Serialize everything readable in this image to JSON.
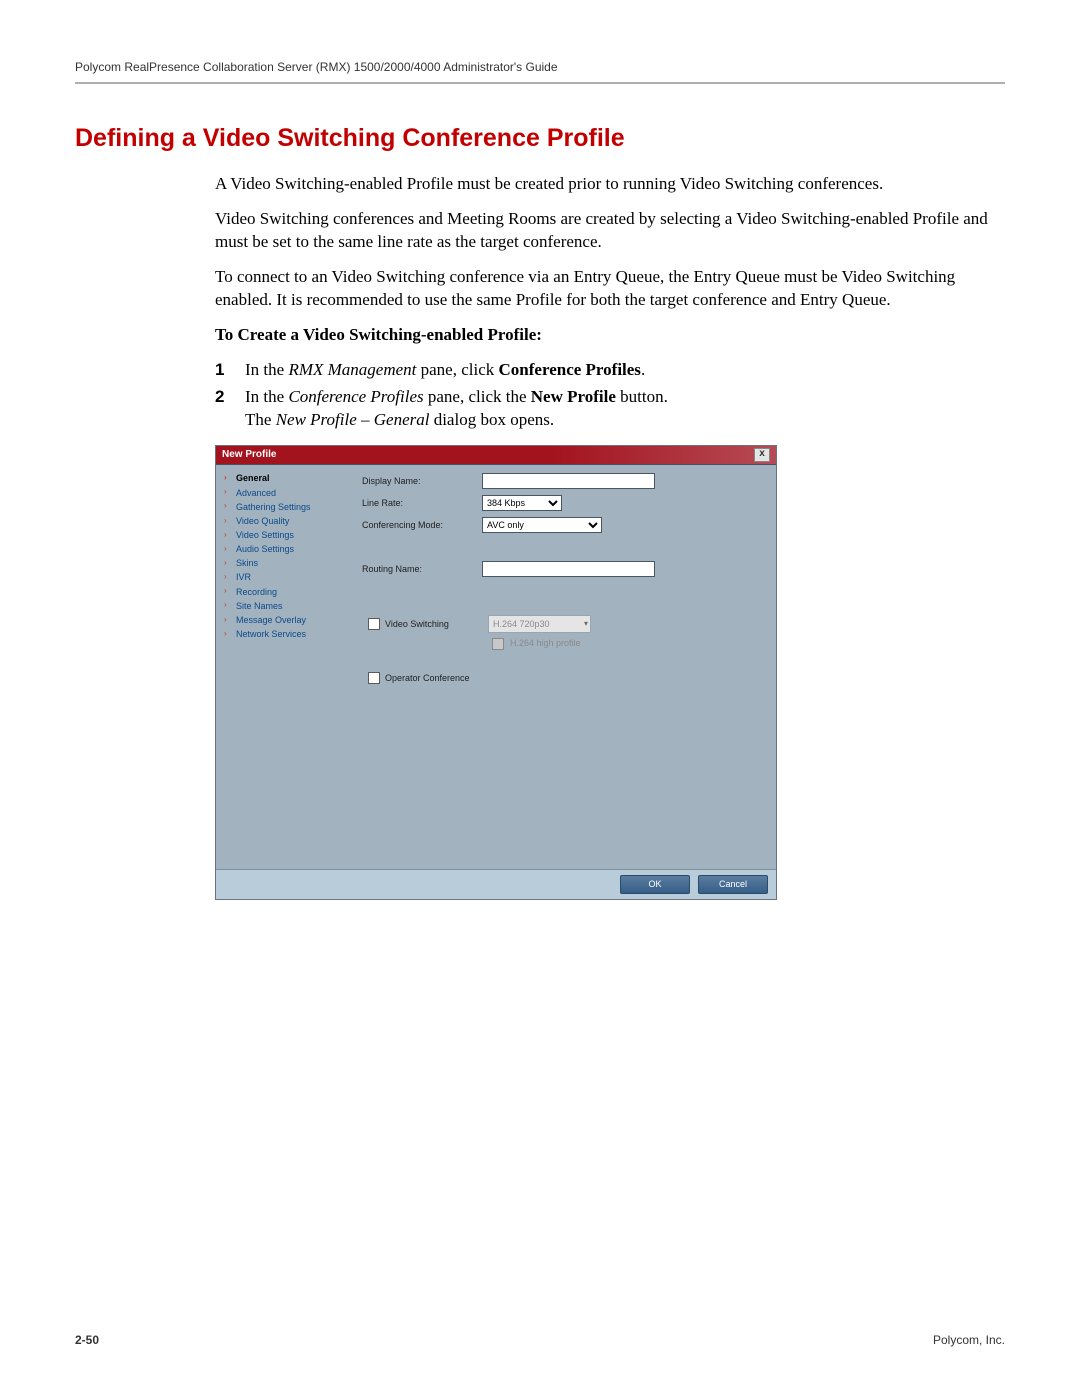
{
  "header": {
    "running": "Polycom RealPresence Collaboration Server (RMX) 1500/2000/4000 Administrator's Guide"
  },
  "title": "Defining a Video Switching Conference Profile",
  "paragraphs": {
    "p1": "A Video Switching-enabled Profile must be created prior to running Video Switching conferences.",
    "p2": "Video Switching conferences and Meeting Rooms are created by selecting a Video Switching-enabled Profile and must be set to the same line rate as the target conference.",
    "p3": "To connect to an Video Switching conference via an Entry Queue, the Entry Queue must be Video Switching enabled. It is recommended to use the same Profile for both the target conference and Entry Queue."
  },
  "subheading": "To Create a Video Switching-enabled Profile:",
  "steps": {
    "s1": {
      "num": "1",
      "pre": "In the ",
      "italic": "RMX Management",
      "mid": " pane, click ",
      "bold": "Conference Profiles",
      "suf": "."
    },
    "s2": {
      "num": "2",
      "pre": "In the ",
      "italic1": "Conference Profiles",
      "mid1": " pane, click the ",
      "bold": "New Profile",
      "mid2": " button.",
      "line2a": "The ",
      "line2b_italic": "New Profile – General",
      "line2c": " dialog box opens."
    }
  },
  "dialog": {
    "title": "New Profile",
    "close": "x",
    "sidebar": [
      {
        "label": "General",
        "selected": true
      },
      {
        "label": "Advanced"
      },
      {
        "label": "Gathering Settings"
      },
      {
        "label": "Video Quality"
      },
      {
        "label": "Video Settings"
      },
      {
        "label": "Audio Settings"
      },
      {
        "label": "Skins"
      },
      {
        "label": "IVR"
      },
      {
        "label": "Recording"
      },
      {
        "label": "Site Names"
      },
      {
        "label": "Message Overlay"
      },
      {
        "label": "Network Services"
      }
    ],
    "form": {
      "display_name_label": "Display Name:",
      "display_name_value": "",
      "line_rate_label": "Line Rate:",
      "line_rate_value": "384 Kbps",
      "conf_mode_label": "Conferencing Mode:",
      "conf_mode_value": "AVC only",
      "routing_label": "Routing Name:",
      "routing_value": "",
      "video_switching_label": "Video Switching",
      "vs_codec_value": "H.264 720p30",
      "vs_high_profile_label": "H.264 high profile",
      "operator_conf_label": "Operator Conference"
    },
    "buttons": {
      "ok": "OK",
      "cancel": "Cancel"
    }
  },
  "footer": {
    "page": "2-50",
    "company": "Polycom, Inc."
  }
}
